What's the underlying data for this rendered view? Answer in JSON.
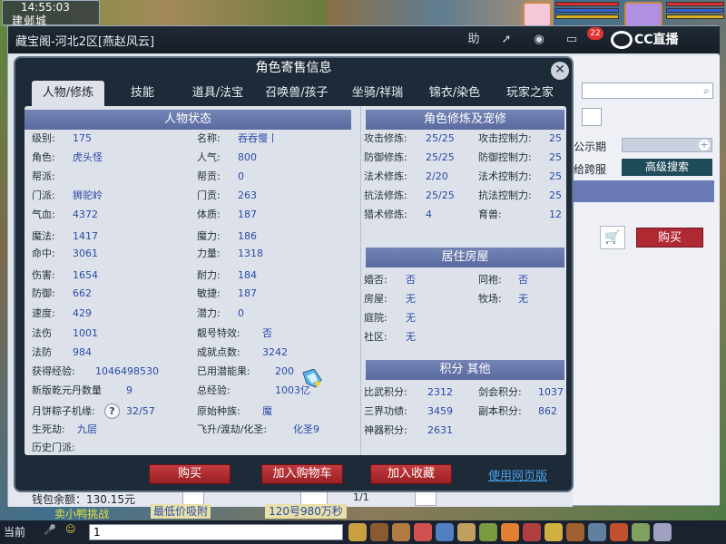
{
  "hud": {
    "clock": "14:55:03",
    "city": "建邺城"
  },
  "outer": {
    "title": "藏宝阁-河北2区[燕赵风云]",
    "notif_count": "22",
    "help_label": "助",
    "cc_brand": "CC直播"
  },
  "right_panel": {
    "label_1": "公示期",
    "label_2": "给跨服",
    "advanced_search": "高级搜索",
    "buy_label": "购买"
  },
  "bottom_strip": {
    "balance": "钱包余额：130.15元",
    "page": "1/1"
  },
  "dialog": {
    "title": "角色寄售信息",
    "tabs": [
      "人物/修炼",
      "技能",
      "道具/法宝",
      "召唤兽/孩子",
      "坐骑/祥瑞",
      "锦衣/染色",
      "玩家之家"
    ],
    "sections": {
      "status": "人物状态",
      "cultivation": "角色修炼及宠修",
      "housing": "居住房屋",
      "points": "积分 其他"
    },
    "status_left": [
      {
        "k": "级别:",
        "v": "175"
      },
      {
        "k": "角色:",
        "v": "虎头怪"
      },
      {
        "k": "帮派:",
        "v": ""
      },
      {
        "k": "门派:",
        "v": "狮驼岭"
      },
      {
        "k": "气血:",
        "v": "4372"
      },
      {
        "k": "魔法:",
        "v": "1417"
      },
      {
        "k": "命中:",
        "v": "3061"
      },
      {
        "k": "伤害:",
        "v": "1654"
      },
      {
        "k": "防御:",
        "v": "662"
      },
      {
        "k": "速度:",
        "v": "429"
      },
      {
        "k": "法伤",
        "v": "1001"
      },
      {
        "k": "法防",
        "v": "984"
      }
    ],
    "status_right": [
      {
        "k": "名称:",
        "v": "吞吞慢丨"
      },
      {
        "k": "人气:",
        "v": "800"
      },
      {
        "k": "帮贡:",
        "v": "0"
      },
      {
        "k": "门贡:",
        "v": "263"
      },
      {
        "k": "体质:",
        "v": "187"
      },
      {
        "k": "魔力:",
        "v": "186"
      },
      {
        "k": "力量:",
        "v": "1318"
      },
      {
        "k": "耐力:",
        "v": "184"
      },
      {
        "k": "敏捷:",
        "v": "187"
      },
      {
        "k": "潜力:",
        "v": "0"
      },
      {
        "k": "靓号特效:",
        "v": "否"
      },
      {
        "k": "成就点数:",
        "v": "3242"
      }
    ],
    "status_bottom": {
      "exp_k": "获得经验:",
      "exp_v": "1046498530",
      "used_k": "已用潜能果:",
      "used_v": "200",
      "pill_k": "新版乾元丹数量",
      "pill_v": "9",
      "total_k": "总经验:",
      "total_v": "1003亿",
      "zongzi_k": "月饼粽子机缘:",
      "zongzi_v": "32/57",
      "race_k": "原始种族:",
      "race_v": "魔",
      "life_k": "生死劫:",
      "life_v": "九层",
      "fly_k": "飞升/渡劫/化圣:",
      "fly_v": "化圣9",
      "hist_k": "历史门派:",
      "hist_v": "",
      "help_q": "?"
    },
    "cultivation": [
      {
        "k1": "攻击修炼:",
        "v1": "25/25",
        "k2": "攻击控制力:",
        "v2": "25"
      },
      {
        "k1": "防御修炼:",
        "v1": "25/25",
        "k2": "防御控制力:",
        "v2": "25"
      },
      {
        "k1": "法术修炼:",
        "v1": "2/20",
        "k2": "法术控制力:",
        "v2": "25"
      },
      {
        "k1": "抗法修炼:",
        "v1": "25/25",
        "k2": "抗法控制力:",
        "v2": "25"
      },
      {
        "k1": "猎术修炼:",
        "v1": "4",
        "k2": "育兽:",
        "v2": "12"
      }
    ],
    "housing": [
      {
        "k1": "婚否:",
        "v1": "否",
        "k2": "同袍:",
        "v2": "否"
      },
      {
        "k1": "房屋:",
        "v1": "无",
        "k2": "牧场:",
        "v2": "无"
      },
      {
        "k1": "庭院:",
        "v1": "无",
        "k2": "",
        "v2": ""
      },
      {
        "k1": "社区:",
        "v1": "无",
        "k2": "",
        "v2": ""
      }
    ],
    "points": [
      {
        "k1": "比武积分:",
        "v1": "2312",
        "k2": "剑会积分:",
        "v2": "1037"
      },
      {
        "k1": "三界功绩:",
        "v1": "3459",
        "k2": "副本积分:",
        "v2": "862"
      },
      {
        "k1": "神器积分:",
        "v1": "2631",
        "k2": "",
        "v2": ""
      }
    ],
    "buttons": {
      "buy": "购买",
      "cart": "加入购物车",
      "favorite": "加入收藏",
      "web": "使用网页版"
    }
  },
  "taskbar": {
    "channel": "当前",
    "input_value": "1"
  },
  "messages": {
    "m1": "卖小鸭挑战",
    "m2": "最低价吸附",
    "m3": "120号980万秒"
  },
  "colors": {
    "accent_red": "#b02832",
    "value_blue": "#2a4aa8",
    "section_header": "#6676aa",
    "dialog_bg": "#1d2b38"
  }
}
